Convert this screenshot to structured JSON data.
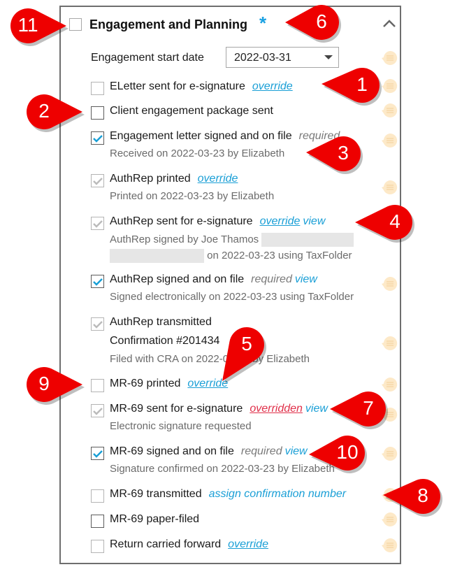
{
  "panel": {
    "title": "Engagement and Planning",
    "required_marker": "*",
    "collapse_icon": "chevron-up-icon",
    "start_date_label": "Engagement start date",
    "start_date_value": "2022-03-31"
  },
  "items": [
    {
      "label": "ELetter sent for e-signature",
      "state": "unchecked-light",
      "link": "override"
    },
    {
      "label": "Client engagement package sent",
      "state": "unchecked-dark"
    },
    {
      "label": "Engagement letter signed and on file",
      "state": "checked",
      "tag": "required",
      "sub": "Received on 2022-03-23 by Elizabeth"
    },
    {
      "label": "AuthRep printed",
      "state": "auto-checked",
      "link": "override",
      "sub": "Printed on 2022-03-23 by Elizabeth"
    },
    {
      "label": "AuthRep sent for e-signature",
      "state": "auto-checked",
      "link": "override",
      "link2": "view",
      "sub": "AuthRep signed by Joe Thamos",
      "sub2": "on 2022-03-23 using TaxFolder"
    },
    {
      "label": "AuthRep signed and on file",
      "state": "checked",
      "tag": "required",
      "link2": "view",
      "sub": "Signed electronically on 2022-03-23 using TaxFolder"
    },
    {
      "label": "AuthRep transmitted",
      "state": "auto-checked",
      "sub_dark": "Confirmation #201434",
      "sub": "Filed with CRA on 2022-03-23 by Elizabeth"
    },
    {
      "label": "MR-69 printed",
      "state": "unchecked-light",
      "link": "override"
    },
    {
      "label": "MR-69 sent for e-signature",
      "state": "auto-checked",
      "overridden": "overridden",
      "link2": "view",
      "sub": "Electronic signature requested"
    },
    {
      "label": "MR-69 signed and on file",
      "state": "checked",
      "tag": "required",
      "link2": "view",
      "sub": "Signature confirmed on 2022-03-23 by Elizabeth"
    },
    {
      "label": "MR-69 transmitted",
      "state": "unchecked-light",
      "assign": "assign confirmation number"
    },
    {
      "label": "MR-69 paper-filed",
      "state": "unchecked-dark"
    },
    {
      "label": "Return carried forward",
      "state": "unchecked-light",
      "link": "override"
    }
  ],
  "callouts": [
    "1",
    "2",
    "3",
    "4",
    "5",
    "6",
    "7",
    "8",
    "9",
    "10",
    "11"
  ],
  "colors": {
    "accent": "#1a9fd6",
    "overridden": "#e0304a",
    "callout": "#ee0000",
    "comment_icon": "#fde9c8"
  }
}
